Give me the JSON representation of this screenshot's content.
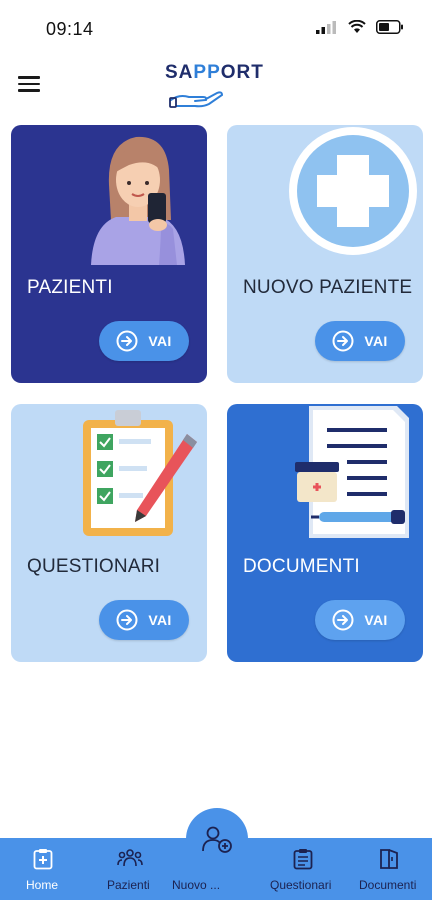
{
  "status": {
    "time": "09:14"
  },
  "header": {
    "logo_text_part1": "SA",
    "logo_text_part2": "PP",
    "logo_text_part3": "ORT"
  },
  "cards": [
    {
      "title": "PAZIENTI",
      "button": "VAI",
      "icon": "woman-phone-illustration"
    },
    {
      "title": "NUOVO PAZIENTE",
      "button": "VAI",
      "icon": "medical-plus-illustration"
    },
    {
      "title": "QUESTIONARI",
      "button": "VAI",
      "icon": "clipboard-checklist-illustration"
    },
    {
      "title": "DOCUMENTI",
      "button": "VAI",
      "icon": "documents-illustration"
    }
  ],
  "bottom_nav": {
    "items": [
      {
        "label": "Home",
        "icon": "home-clipboard-icon",
        "active": true
      },
      {
        "label": "Pazienti",
        "icon": "people-icon",
        "active": false
      },
      {
        "label": "Nuovo ...",
        "icon": "add-user-icon",
        "active": false
      },
      {
        "label": "Questionari",
        "icon": "clipboard-icon",
        "active": false
      },
      {
        "label": "Documenti",
        "icon": "book-icon",
        "active": false
      }
    ]
  },
  "colors": {
    "dark_card": "#2b3490",
    "light_card": "#bfdaf6",
    "blue_card": "#2f6fd1",
    "accent": "#4a92e8",
    "nav_bg": "#4a92e8"
  }
}
